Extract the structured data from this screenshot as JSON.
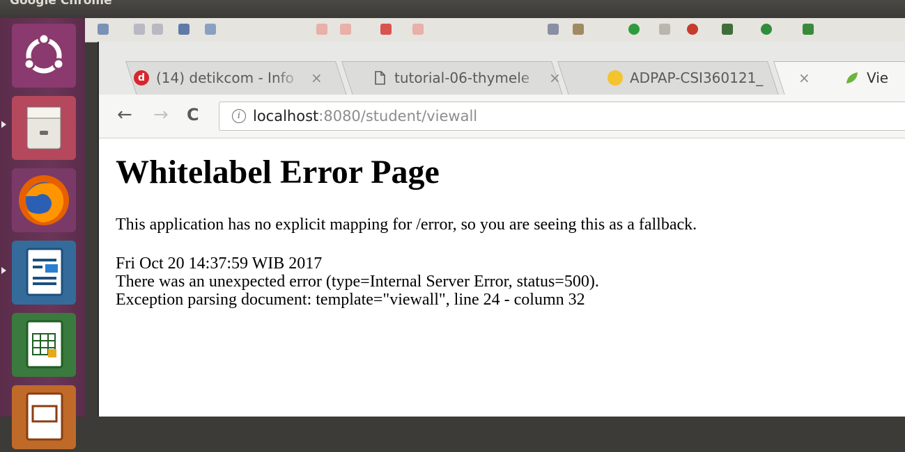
{
  "os": {
    "active_app": "Google Chrome"
  },
  "launcher": {
    "items": [
      "ubuntu-dash",
      "file-manager",
      "firefox",
      "libreoffice-impress",
      "libreoffice-calc",
      "libreoffice-impress-2"
    ]
  },
  "browser": {
    "tabs": [
      {
        "title": "(14) detikcom - Info",
        "icon": "detik-icon",
        "active": false
      },
      {
        "title": "tutorial-06-thymele",
        "icon": "document-icon",
        "active": false
      },
      {
        "title": "ADPAP-CSI360121_",
        "icon": "drive-icon",
        "active": false
      },
      {
        "title": "Vie",
        "icon": "spring-leaf-icon",
        "active": true
      }
    ],
    "close_glyph": "×",
    "nav": {
      "back": "←",
      "forward": "→",
      "reload": "C"
    },
    "address": {
      "info_glyph": "i",
      "host": "localhost",
      "path": ":8080/student/viewall"
    }
  },
  "page": {
    "heading": "Whitelabel Error Page",
    "message": "This application has no explicit mapping for /error, so you are seeing this as a fallback.",
    "timestamp": "Fri Oct 20 14:37:59 WIB 2017",
    "error": "There was an unexpected error (type=Internal Server Error, status=500).",
    "exception": "Exception parsing document: template=\"viewall\", line 24 - column 32"
  }
}
